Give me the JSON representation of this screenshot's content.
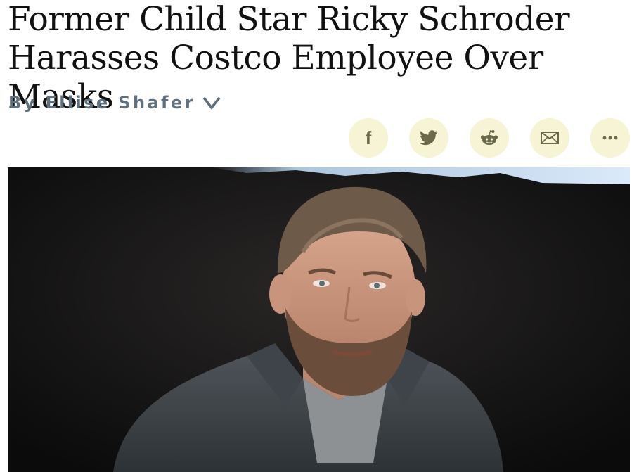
{
  "article": {
    "headline": "Former Child Star Ricky Schroder Harasses Costco Employee Over Masks",
    "byline": "By Ellise Shafer"
  },
  "share": {
    "buttons": [
      {
        "name": "facebook",
        "icon": "facebook-icon"
      },
      {
        "name": "twitter",
        "icon": "twitter-icon"
      },
      {
        "name": "reddit",
        "icon": "reddit-icon"
      },
      {
        "name": "email",
        "icon": "email-icon"
      },
      {
        "name": "more",
        "icon": "more-icon"
      }
    ]
  },
  "colors": {
    "byline": "#5e6f7d",
    "share_bg": "#f6f4d4",
    "share_icon": "#6b6a4c"
  }
}
